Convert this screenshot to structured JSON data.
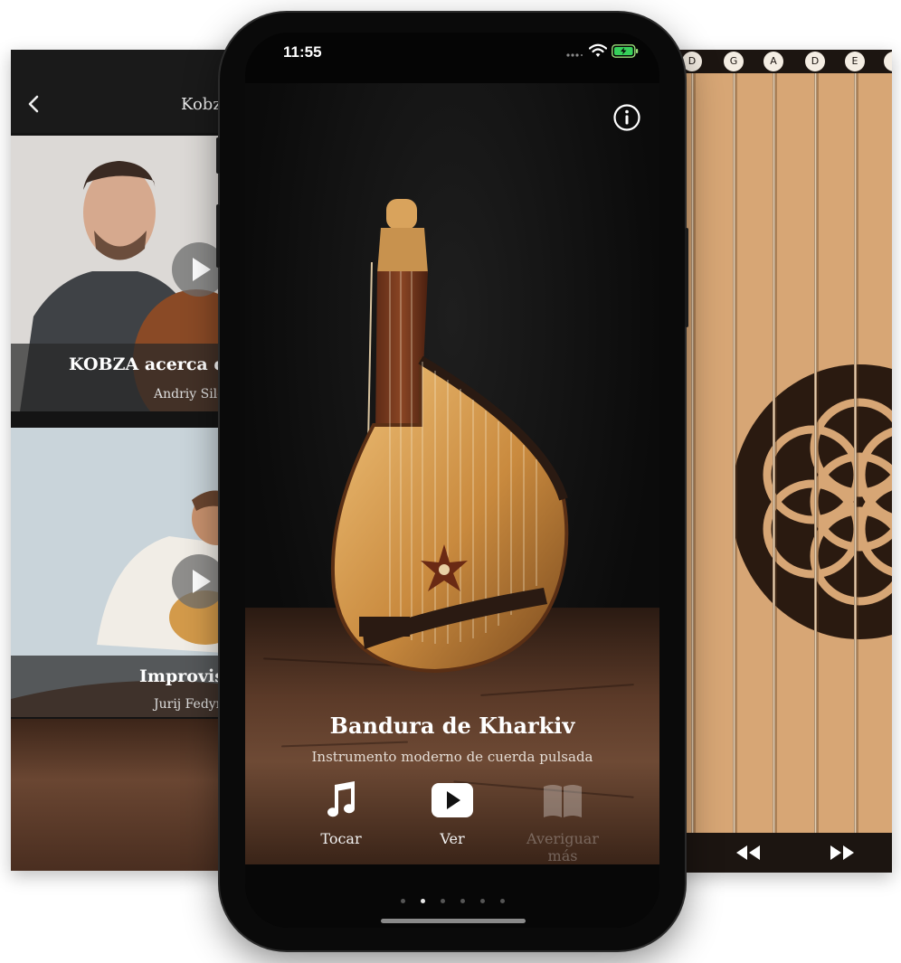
{
  "left_panel": {
    "title": "Kobz",
    "back_icon": "chevron-left-icon",
    "videos": [
      {
        "title": "KOBZA acerca de",
        "author": "Andriy Sile",
        "icon": "play-icon"
      },
      {
        "title": "Improvisa",
        "author": "Jurij Fedyn",
        "icon": "play-icon"
      }
    ]
  },
  "phone": {
    "status_time": "11:55",
    "info_icon": "info-icon",
    "instrument_name": "Bandura de Kharkiv",
    "instrument_subtitle": "Instrumento moderno de cuerda pulsada",
    "actions": [
      {
        "label": "Tocar",
        "icon": "music-note-icon",
        "enabled": true
      },
      {
        "label": "Ver",
        "icon": "video-play-icon",
        "enabled": true
      },
      {
        "label": "Averiguar más",
        "icon": "book-icon",
        "enabled": false
      }
    ],
    "page_count": 6,
    "active_page": 2
  },
  "right_panel": {
    "notes": [
      "D",
      "G",
      "A",
      "D",
      "E"
    ],
    "rewind_icon": "rewind-icon",
    "fast_forward_icon": "fast-forward-icon"
  },
  "colors": {
    "accent_text": "#ffffff",
    "disabled_text": "#5a5a5a",
    "wood": "#d7a675",
    "background": "#0b0b0b"
  }
}
